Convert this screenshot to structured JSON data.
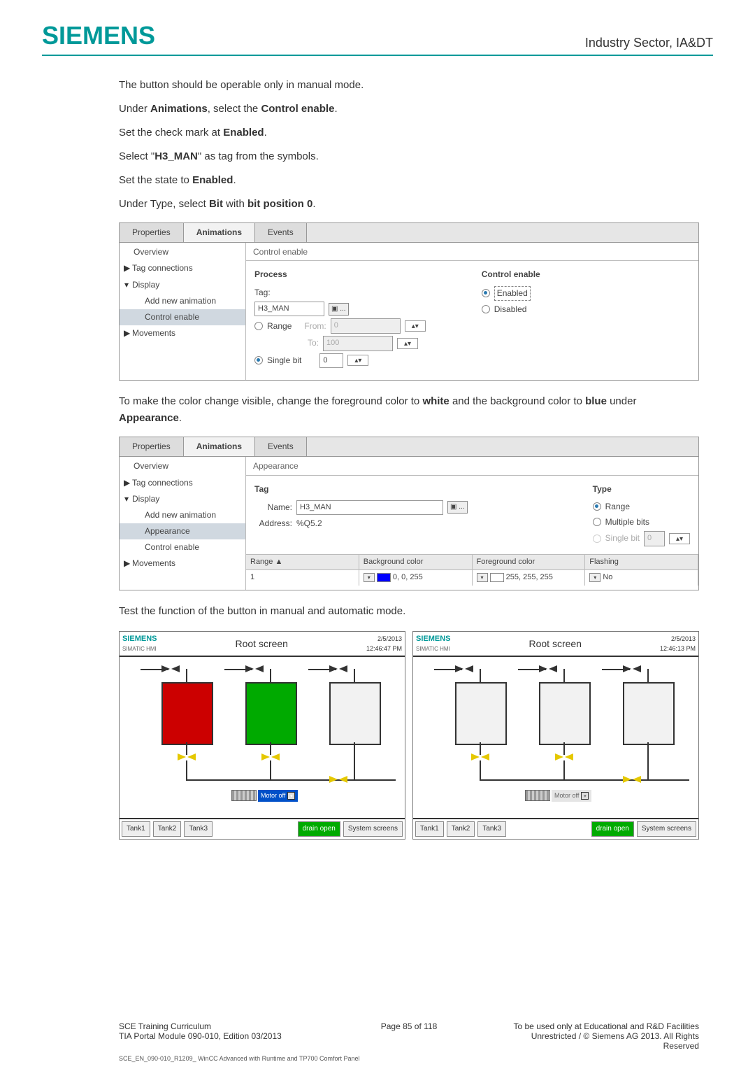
{
  "header": {
    "brand": "SIEMENS",
    "right": "Industry Sector, IA&DT"
  },
  "body": {
    "p1": "The button should be operable only in manual mode.",
    "p2_a": "Under ",
    "p2_b": "Animations",
    "p2_c": ", select the ",
    "p2_d": "Control enable",
    "p2_e": ".",
    "p3_a": "Set the check mark at ",
    "p3_b": "Enabled",
    "p3_c": ".",
    "p4_a": "Select \"",
    "p4_b": "H3_MAN",
    "p4_c": "\" as tag from the symbols.",
    "p5_a": "Set the state to ",
    "p5_b": "Enabled",
    "p5_c": ".",
    "p6_a": "Under Type, select ",
    "p6_b": "Bit",
    "p6_c": " with ",
    "p6_d": "bit position 0",
    "p6_e": ".",
    "mid_a": "To make the color change visible, change the foreground color to ",
    "mid_b": "white",
    "mid_c": " and the background color to ",
    "mid_d": "blue",
    "mid_e": " under ",
    "mid_f": "Appearance",
    "mid_g": ".",
    "test": "Test the function of the button in manual and automatic mode."
  },
  "panel1": {
    "tabs": {
      "properties": "Properties",
      "animations": "Animations",
      "events": "Events"
    },
    "section": "Control enable",
    "tree": {
      "overview": "Overview",
      "tag": "Tag connections",
      "display": "Display",
      "add": "Add new animation",
      "control": "Control enable",
      "move": "Movements"
    },
    "process": {
      "title": "Process",
      "tag_label": "Tag:",
      "tag_value": "H3_MAN",
      "range_label": "Range",
      "from": "From:",
      "from_val": "0",
      "to": "To:",
      "to_val": "100",
      "single_bit": "Single bit",
      "bit_val": "0"
    },
    "ctrl": {
      "title": "Control enable",
      "enabled": "Enabled",
      "disabled": "Disabled"
    }
  },
  "panel2": {
    "tabs": {
      "properties": "Properties",
      "animations": "Animations",
      "events": "Events"
    },
    "section": "Appearance",
    "tree": {
      "overview": "Overview",
      "tag": "Tag connections",
      "display": "Display",
      "add": "Add new animation",
      "appearance": "Appearance",
      "control": "Control enable",
      "move": "Movements"
    },
    "tag": {
      "title": "Tag",
      "name_label": "Name:",
      "name_value": "H3_MAN",
      "addr_label": "Address:",
      "addr_value": "%Q5.2"
    },
    "type": {
      "title": "Type",
      "range": "Range",
      "multi": "Multiple bits",
      "single": "Single bit",
      "single_val": "0"
    },
    "table": {
      "h_range": "Range ▲",
      "h_bg": "Background color",
      "h_fg": "Foreground color",
      "h_flash": "Flashing",
      "row_range": "1",
      "row_bg": "0, 0, 255",
      "row_fg": "255, 255, 255",
      "row_flash": "No"
    }
  },
  "hmi": {
    "brand": "SIEMENS",
    "sub": "SIMATIC HMI",
    "title": "Root screen",
    "left": {
      "date": "2/5/2013",
      "time": "12:46:47 PM"
    },
    "right": {
      "date": "2/5/2013",
      "time": "12:46:13 PM"
    },
    "motor": "Motor off",
    "btns": {
      "t1": "Tank1",
      "t2": "Tank2",
      "t3": "Tank3",
      "drain": "drain open",
      "sys": "System screens"
    }
  },
  "footer": {
    "l1": "SCE Training Curriculum",
    "l2": "TIA Portal Module 090-010, Edition 03/2013",
    "mid": "Page 85 of 118",
    "r1": "To be used only at Educational and R&D Facilities",
    "r2": "Unrestricted / © Siemens AG 2013. All Rights Reserved",
    "small": "SCE_EN_090-010_R1209_ WinCC Advanced with Runtime and TP700 Comfort Panel"
  }
}
